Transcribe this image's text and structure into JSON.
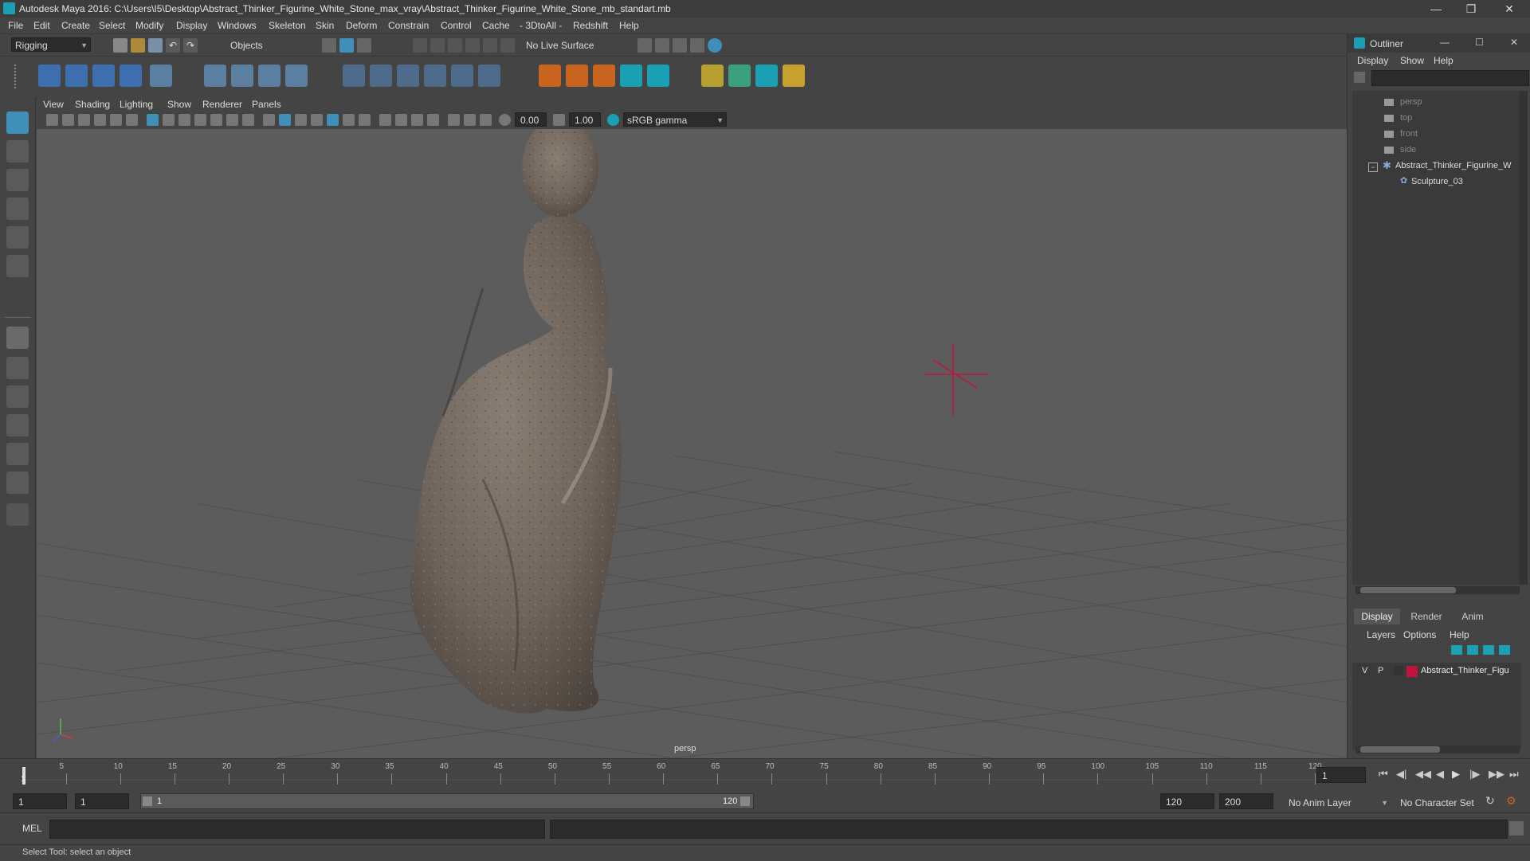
{
  "window": {
    "title": "Autodesk Maya 2016: C:\\Users\\I5\\Desktop\\Abstract_Thinker_Figurine_White_Stone_max_vray\\Abstract_Thinker_Figurine_White_Stone_mb_standart.mb"
  },
  "menubar": [
    "File",
    "Edit",
    "Create",
    "Select",
    "Modify",
    "Display",
    "Windows",
    "Skeleton",
    "Skin",
    "Deform",
    "Constrain",
    "Control",
    "Cache",
    "- 3DtoAll -",
    "Redshift",
    "Help"
  ],
  "statusline": {
    "mode": "Rigging",
    "objects": "Objects",
    "live_surface": "No Live Surface"
  },
  "panel": {
    "menus": [
      "View",
      "Shading",
      "Lighting",
      "Show",
      "Renderer",
      "Panels"
    ],
    "value1": "0.00",
    "value2": "1.00",
    "colorspace": "sRGB gamma",
    "camera_label": "persp"
  },
  "outliner": {
    "title": "Outliner",
    "menus": [
      "Display",
      "Show",
      "Help"
    ],
    "items": [
      {
        "label": "persp"
      },
      {
        "label": "top"
      },
      {
        "label": "front"
      },
      {
        "label": "side"
      },
      {
        "label": "Abstract_Thinker_Figurine_W"
      },
      {
        "label": "Sculpture_03"
      }
    ]
  },
  "layers": {
    "tabs": [
      "Display",
      "Render",
      "Anim"
    ],
    "menus": [
      "Layers",
      "Options",
      "Help"
    ],
    "row": {
      "v": "V",
      "p": "P",
      "name": "Abstract_Thinker_Figu",
      "color": "#c0143c"
    }
  },
  "timeline": {
    "ticks": [
      "5",
      "10",
      "15",
      "20",
      "25",
      "30",
      "35",
      "40",
      "45",
      "50",
      "55",
      "60",
      "65",
      "70",
      "75",
      "80",
      "85",
      "90",
      "95",
      "100",
      "105",
      "110",
      "115",
      "120"
    ],
    "start_tick": "1",
    "current_frame": "1"
  },
  "range": {
    "start": "1",
    "playback_start": "1",
    "slider_start": "1",
    "slider_end": "120",
    "playback_end": "120",
    "end": "200",
    "anim_layer": "No Anim Layer",
    "character_set": "No Character Set"
  },
  "cmdline": {
    "label": "MEL"
  },
  "helpline": {
    "text": "Select Tool: select an object"
  },
  "colors": {
    "accent": "#1a9fb4",
    "layer_color": "#c0143c",
    "manipulator": "#c0143c"
  }
}
